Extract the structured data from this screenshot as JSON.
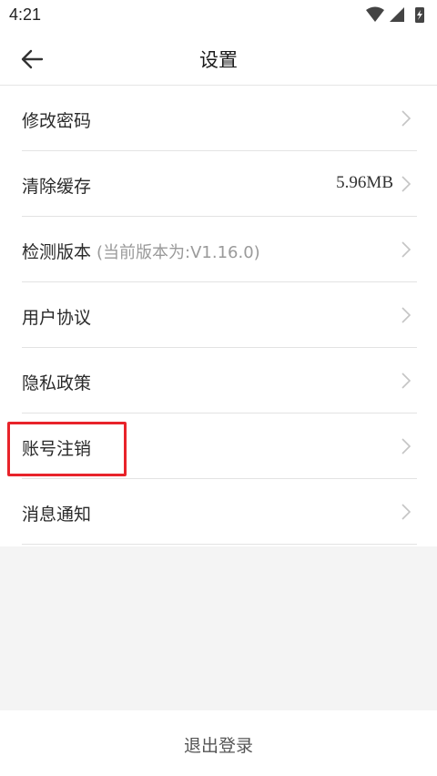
{
  "status_bar": {
    "time": "4:21",
    "icons": [
      "wifi-icon",
      "signal-icon",
      "battery-icon"
    ]
  },
  "header": {
    "title": "设置",
    "back_icon": "arrow-left-icon"
  },
  "settings": {
    "items": [
      {
        "label": "修改密码"
      },
      {
        "label": "清除缓存",
        "value": "5.96MB"
      },
      {
        "label": "检测版本",
        "sub": "(当前版本为:V1.16.0)"
      },
      {
        "label": "用户协议"
      },
      {
        "label": "隐私政策"
      },
      {
        "label": "账号注销"
      },
      {
        "label": "消息通知"
      }
    ]
  },
  "footer": {
    "logout_label": "退出登录"
  },
  "colors": {
    "highlight": "#e8232a",
    "divider": "#e3e3e3",
    "background": "#f4f4f4"
  }
}
